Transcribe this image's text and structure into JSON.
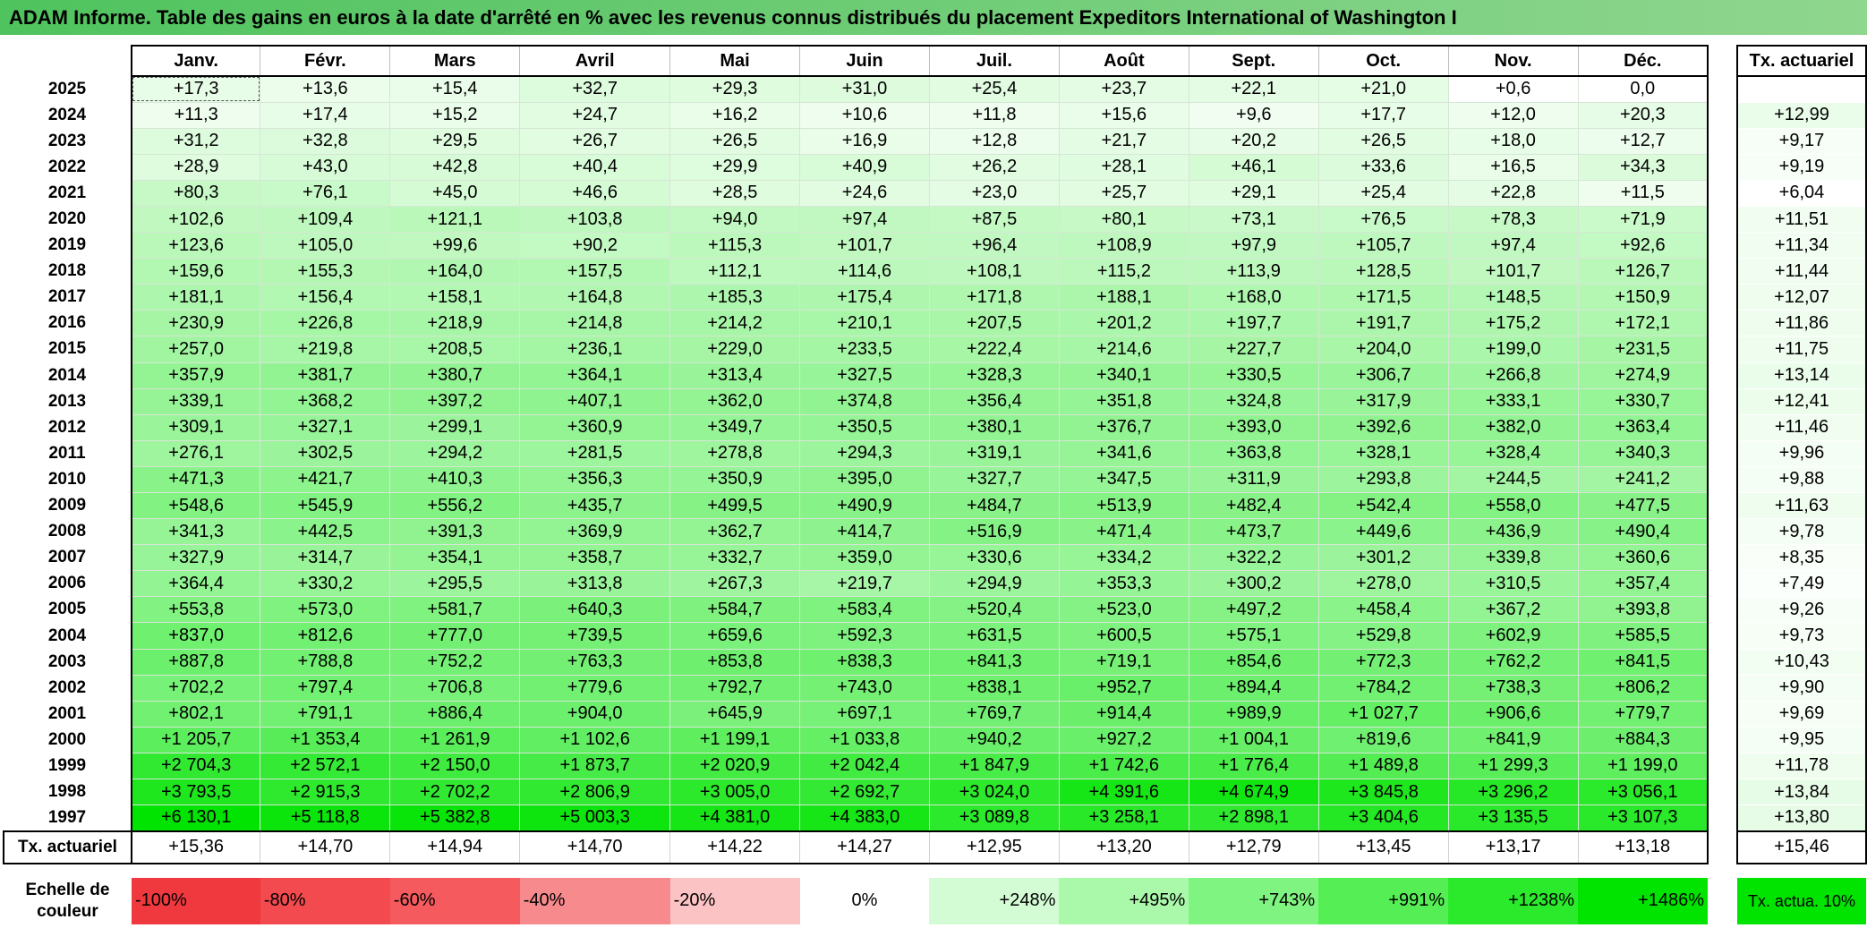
{
  "title": "ADAM Informe. Table des gains en euros à la date d'arrêté en % avec les revenus connus distribués du placement Expeditors International of Washington I",
  "months": [
    "Janv.",
    "Févr.",
    "Mars",
    "Avril",
    "Mai",
    "Juin",
    "Juil.",
    "Août",
    "Sept.",
    "Oct.",
    "Nov.",
    "Déc."
  ],
  "tx_header": "Tx. actuariel",
  "rows": [
    {
      "year": "2025",
      "values": [
        "+17,3",
        "+13,6",
        "+15,4",
        "+32,7",
        "+29,3",
        "+31,0",
        "+25,4",
        "+23,7",
        "+22,1",
        "+21,0",
        "+0,6",
        "0,0"
      ],
      "tx": ""
    },
    {
      "year": "2024",
      "values": [
        "+11,3",
        "+17,4",
        "+15,2",
        "+24,7",
        "+16,2",
        "+10,6",
        "+11,8",
        "+15,6",
        "+9,6",
        "+17,7",
        "+12,0",
        "+20,3"
      ],
      "tx": "+12,99"
    },
    {
      "year": "2023",
      "values": [
        "+31,2",
        "+32,8",
        "+29,5",
        "+26,7",
        "+26,5",
        "+16,9",
        "+12,8",
        "+21,7",
        "+20,2",
        "+26,5",
        "+18,0",
        "+12,7"
      ],
      "tx": "+9,17"
    },
    {
      "year": "2022",
      "values": [
        "+28,9",
        "+43,0",
        "+42,8",
        "+40,4",
        "+29,9",
        "+40,9",
        "+26,2",
        "+28,1",
        "+46,1",
        "+33,6",
        "+16,5",
        "+34,3"
      ],
      "tx": "+9,19"
    },
    {
      "year": "2021",
      "values": [
        "+80,3",
        "+76,1",
        "+45,0",
        "+46,6",
        "+28,5",
        "+24,6",
        "+23,0",
        "+25,7",
        "+29,1",
        "+25,4",
        "+22,8",
        "+11,5"
      ],
      "tx": "+6,04"
    },
    {
      "year": "2020",
      "values": [
        "+102,6",
        "+109,4",
        "+121,1",
        "+103,8",
        "+94,0",
        "+97,4",
        "+87,5",
        "+80,1",
        "+73,1",
        "+76,5",
        "+78,3",
        "+71,9"
      ],
      "tx": "+11,51"
    },
    {
      "year": "2019",
      "values": [
        "+123,6",
        "+105,0",
        "+99,6",
        "+90,2",
        "+115,3",
        "+101,7",
        "+96,4",
        "+108,9",
        "+97,9",
        "+105,7",
        "+97,4",
        "+92,6"
      ],
      "tx": "+11,34"
    },
    {
      "year": "2018",
      "values": [
        "+159,6",
        "+155,3",
        "+164,0",
        "+157,5",
        "+112,1",
        "+114,6",
        "+108,1",
        "+115,2",
        "+113,9",
        "+128,5",
        "+101,7",
        "+126,7"
      ],
      "tx": "+11,44"
    },
    {
      "year": "2017",
      "values": [
        "+181,1",
        "+156,4",
        "+158,1",
        "+164,8",
        "+185,3",
        "+175,4",
        "+171,8",
        "+188,1",
        "+168,0",
        "+171,5",
        "+148,5",
        "+150,9"
      ],
      "tx": "+12,07"
    },
    {
      "year": "2016",
      "values": [
        "+230,9",
        "+226,8",
        "+218,9",
        "+214,8",
        "+214,2",
        "+210,1",
        "+207,5",
        "+201,2",
        "+197,7",
        "+191,7",
        "+175,2",
        "+172,1"
      ],
      "tx": "+11,86"
    },
    {
      "year": "2015",
      "values": [
        "+257,0",
        "+219,8",
        "+208,5",
        "+236,1",
        "+229,0",
        "+233,5",
        "+222,4",
        "+214,6",
        "+227,7",
        "+204,0",
        "+199,0",
        "+231,5"
      ],
      "tx": "+11,75"
    },
    {
      "year": "2014",
      "values": [
        "+357,9",
        "+381,7",
        "+380,7",
        "+364,1",
        "+313,4",
        "+327,5",
        "+328,3",
        "+340,1",
        "+330,5",
        "+306,7",
        "+266,8",
        "+274,9"
      ],
      "tx": "+13,14"
    },
    {
      "year": "2013",
      "values": [
        "+339,1",
        "+368,2",
        "+397,2",
        "+407,1",
        "+362,0",
        "+374,8",
        "+356,4",
        "+351,8",
        "+324,8",
        "+317,9",
        "+333,1",
        "+330,7"
      ],
      "tx": "+12,41"
    },
    {
      "year": "2012",
      "values": [
        "+309,1",
        "+327,1",
        "+299,1",
        "+360,9",
        "+349,7",
        "+350,5",
        "+380,1",
        "+376,7",
        "+393,0",
        "+392,6",
        "+382,0",
        "+363,4"
      ],
      "tx": "+11,46"
    },
    {
      "year": "2011",
      "values": [
        "+276,1",
        "+302,5",
        "+294,2",
        "+281,5",
        "+278,8",
        "+294,3",
        "+319,1",
        "+341,6",
        "+363,8",
        "+328,1",
        "+328,4",
        "+340,3"
      ],
      "tx": "+9,96"
    },
    {
      "year": "2010",
      "values": [
        "+471,3",
        "+421,7",
        "+410,3",
        "+356,3",
        "+350,9",
        "+395,0",
        "+327,7",
        "+347,5",
        "+311,9",
        "+293,8",
        "+244,5",
        "+241,2"
      ],
      "tx": "+9,88"
    },
    {
      "year": "2009",
      "values": [
        "+548,6",
        "+545,9",
        "+556,2",
        "+435,7",
        "+499,5",
        "+490,9",
        "+484,7",
        "+513,9",
        "+482,4",
        "+542,4",
        "+558,0",
        "+477,5"
      ],
      "tx": "+11,63"
    },
    {
      "year": "2008",
      "values": [
        "+341,3",
        "+442,5",
        "+391,3",
        "+369,9",
        "+362,7",
        "+414,7",
        "+516,9",
        "+471,4",
        "+473,7",
        "+449,6",
        "+436,9",
        "+490,4"
      ],
      "tx": "+9,78"
    },
    {
      "year": "2007",
      "values": [
        "+327,9",
        "+314,7",
        "+354,1",
        "+358,7",
        "+332,7",
        "+359,0",
        "+330,6",
        "+334,2",
        "+322,2",
        "+301,2",
        "+339,8",
        "+360,6"
      ],
      "tx": "+8,35"
    },
    {
      "year": "2006",
      "values": [
        "+364,4",
        "+330,2",
        "+295,5",
        "+313,8",
        "+267,3",
        "+219,7",
        "+294,9",
        "+353,3",
        "+300,2",
        "+278,0",
        "+310,5",
        "+357,4"
      ],
      "tx": "+7,49"
    },
    {
      "year": "2005",
      "values": [
        "+553,8",
        "+573,0",
        "+581,7",
        "+640,3",
        "+584,7",
        "+583,4",
        "+520,4",
        "+523,0",
        "+497,2",
        "+458,4",
        "+367,2",
        "+393,8"
      ],
      "tx": "+9,26"
    },
    {
      "year": "2004",
      "values": [
        "+837,0",
        "+812,6",
        "+777,0",
        "+739,5",
        "+659,6",
        "+592,3",
        "+631,5",
        "+600,5",
        "+575,1",
        "+529,8",
        "+602,9",
        "+585,5"
      ],
      "tx": "+9,73"
    },
    {
      "year": "2003",
      "values": [
        "+887,8",
        "+788,8",
        "+752,2",
        "+763,3",
        "+853,8",
        "+838,3",
        "+841,3",
        "+719,1",
        "+854,6",
        "+772,3",
        "+762,2",
        "+841,5"
      ],
      "tx": "+10,43"
    },
    {
      "year": "2002",
      "values": [
        "+702,2",
        "+797,4",
        "+706,8",
        "+779,6",
        "+792,7",
        "+743,0",
        "+838,1",
        "+952,7",
        "+894,4",
        "+784,2",
        "+738,3",
        "+806,2"
      ],
      "tx": "+9,90"
    },
    {
      "year": "2001",
      "values": [
        "+802,1",
        "+791,1",
        "+886,4",
        "+904,0",
        "+645,9",
        "+697,1",
        "+769,7",
        "+914,4",
        "+989,9",
        "+1 027,7",
        "+906,6",
        "+779,7"
      ],
      "tx": "+9,69"
    },
    {
      "year": "2000",
      "values": [
        "+1 205,7",
        "+1 353,4",
        "+1 261,9",
        "+1 102,6",
        "+1 199,1",
        "+1 033,8",
        "+940,2",
        "+927,2",
        "+1 004,1",
        "+819,6",
        "+841,9",
        "+884,3"
      ],
      "tx": "+9,95"
    },
    {
      "year": "1999",
      "values": [
        "+2 704,3",
        "+2 572,1",
        "+2 150,0",
        "+1 873,7",
        "+2 020,9",
        "+2 042,4",
        "+1 847,9",
        "+1 742,6",
        "+1 776,4",
        "+1 489,8",
        "+1 299,3",
        "+1 199,0"
      ],
      "tx": "+11,78"
    },
    {
      "year": "1998",
      "values": [
        "+3 793,5",
        "+2 915,3",
        "+2 702,2",
        "+2 806,9",
        "+3 005,0",
        "+2 692,7",
        "+3 024,0",
        "+4 391,6",
        "+4 674,9",
        "+3 845,8",
        "+3 296,2",
        "+3 056,1"
      ],
      "tx": "+13,84"
    },
    {
      "year": "1997",
      "values": [
        "+6 130,1",
        "+5 118,8",
        "+5 382,8",
        "+5 003,3",
        "+4 381,0",
        "+4 383,0",
        "+3 089,8",
        "+3 258,1",
        "+2 898,1",
        "+3 404,6",
        "+3 135,5",
        "+3 107,3"
      ],
      "tx": "+13,80"
    }
  ],
  "annual": {
    "label": "Tx. actuariel",
    "values": [
      "+15,36",
      "+14,70",
      "+14,94",
      "+14,70",
      "+14,22",
      "+14,27",
      "+12,95",
      "+13,20",
      "+12,79",
      "+13,45",
      "+13,17",
      "+13,18"
    ],
    "tx": "+15,46"
  },
  "scale": {
    "label": "Echelle de couleur",
    "steps": [
      {
        "label": "-100%",
        "color": "#f0383f"
      },
      {
        "label": "-80%",
        "color": "#f24a4e"
      },
      {
        "label": "-60%",
        "color": "#f45a5e"
      },
      {
        "label": "-40%",
        "color": "#f78a8c"
      },
      {
        "label": "-20%",
        "color": "#fbc3c4"
      },
      {
        "label": "0%",
        "color": "#ffffff"
      },
      {
        "label": "+248%",
        "color": "#d4fcd4"
      },
      {
        "label": "+495%",
        "color": "#aaf8aa"
      },
      {
        "label": "+743%",
        "color": "#80f480"
      },
      {
        "label": "+991%",
        "color": "#55ef55"
      },
      {
        "label": "+1238%",
        "color": "#2be92b"
      },
      {
        "label": "+1486%",
        "color": "#00e400"
      }
    ],
    "tx_legend": "Tx. actua. 10%",
    "tx_legend_color": "#00e400"
  },
  "colors": {
    "title_bg": "#5cc86a",
    "max_green": "#00e400"
  }
}
